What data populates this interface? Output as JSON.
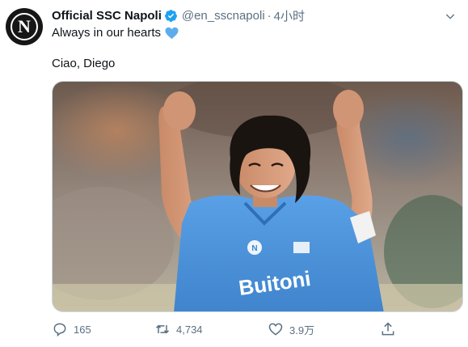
{
  "tweet": {
    "display_name": "Official SSC Napoli",
    "handle": "@en_sscnapoli",
    "separator": "·",
    "time": "4小时",
    "avatar_letter": "N",
    "line1": "Always in our hearts",
    "line2": "Ciao, Diego",
    "media_shirt_text": "Buitoni",
    "stats": {
      "replies": "165",
      "retweets": "4,734",
      "likes": "3.9万"
    }
  },
  "icons": {
    "verified": "verified-badge-icon",
    "caret": "chevron-down-icon",
    "heart_emoji": "blue-heart-emoji",
    "reply": "reply-icon",
    "retweet": "retweet-icon",
    "like": "heart-icon",
    "share": "share-icon"
  },
  "colors": {
    "verified_blue": "#1da1f2",
    "heart_blue": "#5dadec",
    "secondary_text": "#5b7083",
    "shirt_blue": "#4a90d9"
  }
}
